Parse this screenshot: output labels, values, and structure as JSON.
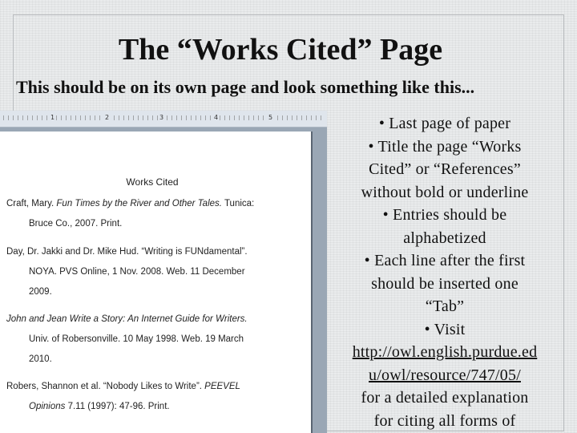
{
  "slide": {
    "title": "The “Works Cited” Page",
    "subtitle": "This should be on its own page and look something like this..."
  },
  "document": {
    "ruler_numbers": [
      "1",
      "2",
      "3",
      "4",
      "5"
    ],
    "heading": "Works Cited",
    "entries": [
      {
        "line1_prefix": "Craft, Mary. ",
        "line1_italic": "Fun Times by the River and Other Tales.",
        "line1_suffix": " Tunica:",
        "line2": "Bruce Co., 2007. Print."
      },
      {
        "line1_prefix": "Day, Dr. Jakki and Dr. Mike Hud. “Writing is FUNdamental”.",
        "line1_italic": "",
        "line1_suffix": "",
        "line2": "NOYA. PVS Online, 1 Nov. 2008. Web. 11 December",
        "line3": "2009."
      },
      {
        "line1_prefix": "",
        "line1_italic": "John and Jean Write a Story: An Internet Guide for Writers.",
        "line1_suffix": "",
        "line2": "Univ. of Robersonville. 10 May 1998. Web. 19 March",
        "line3": "2010."
      },
      {
        "line1_prefix": "Robers, Shannon et al. “Nobody Likes to Write”. ",
        "line1_italic": "PEEVEL",
        "line1_suffix": "",
        "line2_italic": "Opinions",
        "line2": " 7.11 (1997): 47-96. Print."
      }
    ]
  },
  "bullets": {
    "lines": [
      "• Last page of paper",
      "• Title the page “Works",
      "Cited” or “References”",
      "without bold or underline",
      "• Entries should be",
      "alphabetized",
      "• Each line after the first",
      "should be inserted one",
      "“Tab”",
      "• Visit"
    ],
    "link_line1": "http://owl.english.purdue.ed",
    "link_line2": "u/owl/resource/747/05/",
    "after_lines": [
      "for a detailed explanation",
      "for citing all forms of"
    ]
  }
}
